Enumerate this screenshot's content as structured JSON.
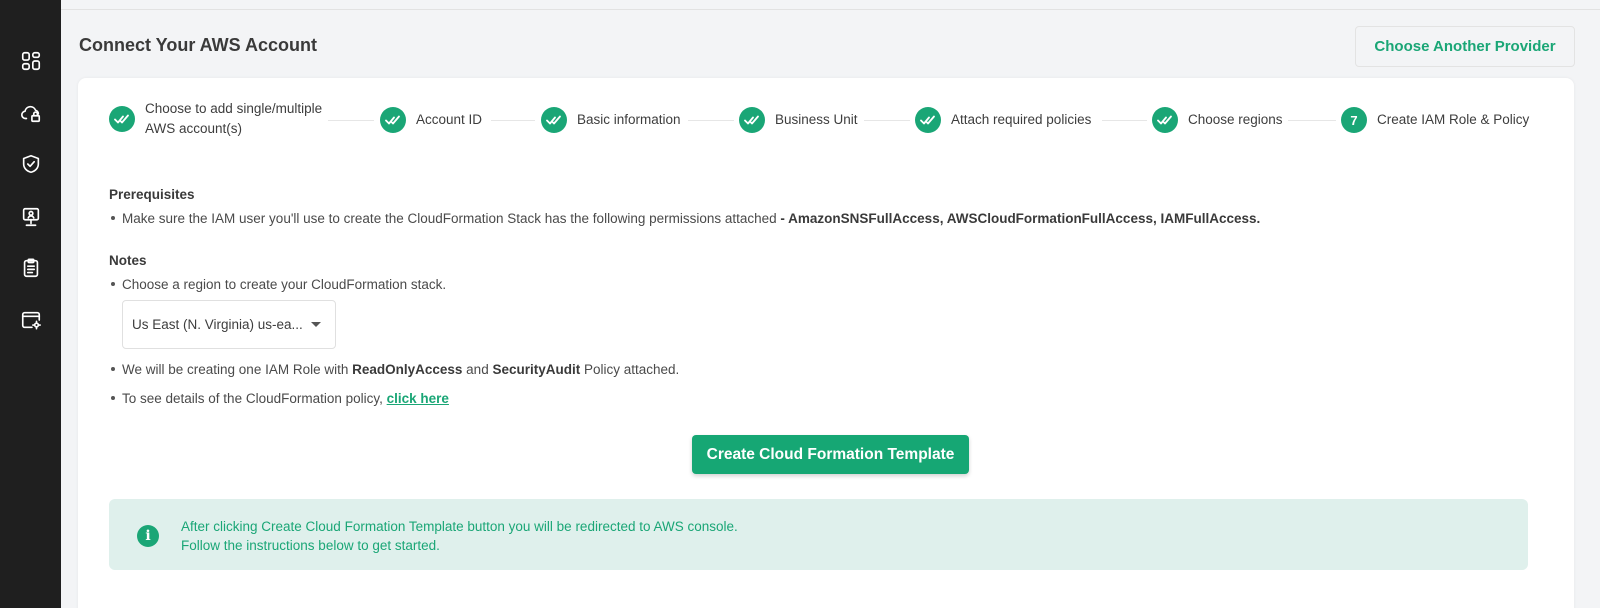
{
  "sidebar": {
    "items": [
      {
        "name": "dashboard",
        "icon": "dashboard-icon"
      },
      {
        "name": "cloud-lock",
        "icon": "cloud-lock-icon"
      },
      {
        "name": "shield",
        "icon": "shield-check-icon"
      },
      {
        "name": "monitor-user",
        "icon": "monitor-user-icon"
      },
      {
        "name": "clipboard",
        "icon": "clipboard-icon"
      },
      {
        "name": "settings-window",
        "icon": "window-settings-icon"
      }
    ]
  },
  "header": {
    "title": "Connect Your AWS Account",
    "provider_button": "Choose Another Provider"
  },
  "stepper": {
    "steps": [
      {
        "line1": "Choose to add single/multiple",
        "line2": "AWS account(s)",
        "done": true
      },
      {
        "label": "Account ID",
        "done": true
      },
      {
        "label": "Basic information",
        "done": true
      },
      {
        "label": "Business Unit",
        "done": true
      },
      {
        "label": "Attach required policies",
        "done": true
      },
      {
        "label": "Choose regions",
        "done": true
      },
      {
        "label": "Create IAM Role & Policy",
        "number": "7",
        "done": false
      }
    ]
  },
  "prerequisites": {
    "title": "Prerequisites",
    "text": "Make sure the IAM user you'll use to create the CloudFormation Stack has the following permissions attached ",
    "permissions": "- AmazonSNSFullAccess, AWSCloudFormationFullAccess, IAMFullAccess."
  },
  "notes": {
    "title": "Notes",
    "region_text": "Choose a region to create your CloudFormation stack.",
    "region_select": "Us East (N. Virginia) us-ea...",
    "role_prefix": "We will be creating one IAM Role with ",
    "role_policy1": "ReadOnlyAccess",
    "role_mid": " and ",
    "role_policy2": "SecurityAudit",
    "role_suffix": " Policy attached.",
    "details_prefix": "To see details of the CloudFormation policy, ",
    "details_link": "click here"
  },
  "cta": {
    "label": "Create Cloud Formation Template"
  },
  "info": {
    "icon": "info-icon",
    "line1": "After clicking Create Cloud Formation Template button you will be redirected to AWS console.",
    "line2": "Follow the instructions below to get started."
  },
  "colors": {
    "accent": "#1aa676",
    "sidebar": "#1f1f1f",
    "info_bg": "#dff0ec"
  }
}
